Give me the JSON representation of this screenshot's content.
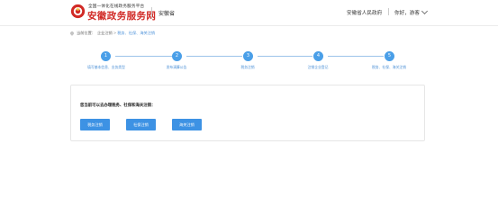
{
  "header": {
    "logo_subtitle": "全国一体化在线政务服务平台",
    "logo_title": "安徽政务服务网",
    "region": "安徽省",
    "gov_link": "安徽省人民政府",
    "user_greeting": "你好，游客"
  },
  "breadcrumb": {
    "prefix": "当前位置：",
    "parent": "企业注销",
    "separator": ">",
    "current": "税务、社保、海关注销"
  },
  "steps": [
    {
      "number": "1",
      "label": "填写基本信息、业务类型"
    },
    {
      "number": "2",
      "label": "发布清算公告"
    },
    {
      "number": "3",
      "label": "税务注销"
    },
    {
      "number": "4",
      "label": "注销企业登记"
    },
    {
      "number": "5",
      "label": "税务、社保、海关注销"
    }
  ],
  "panel": {
    "prompt": "您当前可以去办理税务、社保和海关注销：",
    "buttons": [
      {
        "label": "税务注销"
      },
      {
        "label": "社保注销"
      },
      {
        "label": "海关注销"
      }
    ]
  },
  "colors": {
    "brand_red": "#d12a26",
    "step_blue": "#4a9fe8",
    "button_blue": "#3d92e4",
    "link_blue": "#4a8fd6"
  }
}
